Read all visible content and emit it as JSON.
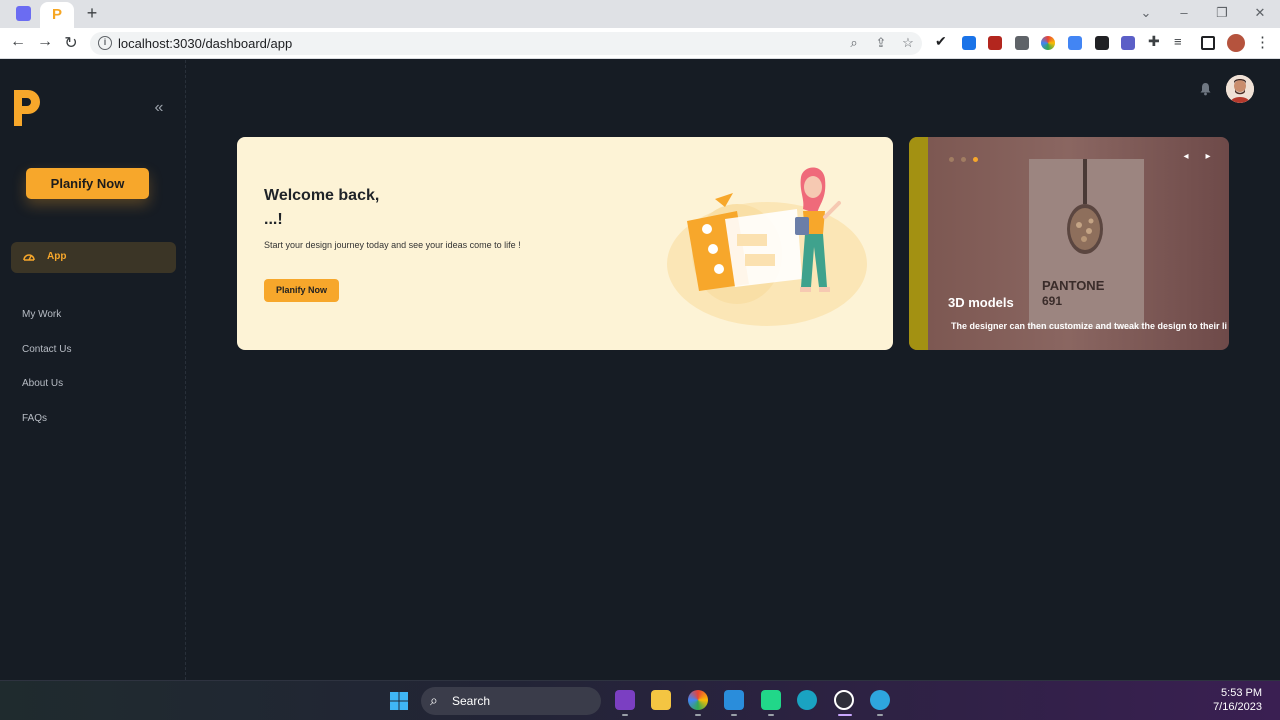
{
  "browser": {
    "url": "localhost:3030/dashboard/app",
    "new_tab_glyph": "+",
    "tab_logo_letter": "P"
  },
  "sidebar": {
    "collapse_glyph": "«",
    "cta_label": "Planify Now",
    "active_item": "App",
    "items": [
      "My Work",
      "Contact Us",
      "About Us",
      "FAQs"
    ]
  },
  "welcome": {
    "title": "Welcome back,",
    "subtitle": "...!",
    "description": "Start your design journey today and see your ideas come to life !",
    "cta_label": "Planify Now"
  },
  "carousel": {
    "title": "3D models",
    "text": "The designer can then customize and tweak the design to their li",
    "pantone_label": "PANTONE",
    "pantone_number": "691",
    "prev_glyph": "◂",
    "next_glyph": "▸",
    "active_slide_index": 3,
    "slide_count": 3
  },
  "taskbar": {
    "search_label": "Search",
    "time": "5:53 PM",
    "date": "7/16/2023"
  },
  "colors": {
    "accent": "#f7a72b",
    "background": "#161c24",
    "welcome_card": "#fdf3d6"
  }
}
